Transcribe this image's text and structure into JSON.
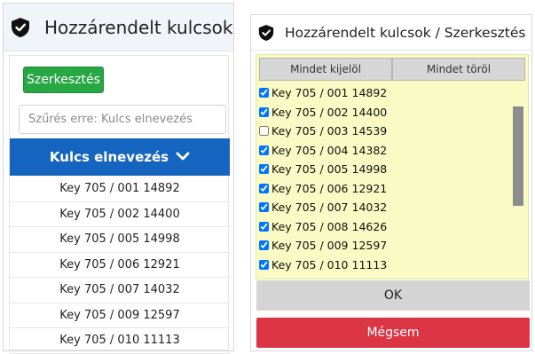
{
  "left_panel": {
    "title": "Hozzárendelt kulcsok",
    "edit_label": "Szerkesztés",
    "filter_placeholder": "Szűrés erre: Kulcs elnevezés",
    "column_header": "Kulcs elnevezés",
    "keys": [
      "Key 705 / 001 14892",
      "Key 705 / 002 14400",
      "Key 705 / 005 14998",
      "Key 705 / 006 12921",
      "Key 705 / 007 14032",
      "Key 705 / 009 12597",
      "Key 705 / 010 11113"
    ]
  },
  "dialog": {
    "title": "Hozzárendelt kulcsok / Szerkesztés",
    "select_all_label": "Mindet kijelöl",
    "clear_all_label": "Mindet töröl",
    "items": [
      {
        "label": "Key 705 / 001 14892",
        "checked": true
      },
      {
        "label": "Key 705 / 002 14400",
        "checked": true
      },
      {
        "label": "Key 705 / 003 14539",
        "checked": false
      },
      {
        "label": "Key 705 / 004 14382",
        "checked": true
      },
      {
        "label": "Key 705 / 005 14998",
        "checked": true
      },
      {
        "label": "Key 705 / 006 12921",
        "checked": true
      },
      {
        "label": "Key 705 / 007 14032",
        "checked": true
      },
      {
        "label": "Key 705 / 008 14626",
        "checked": true
      },
      {
        "label": "Key 705 / 009 12597",
        "checked": true
      },
      {
        "label": "Key 705 / 010 11113",
        "checked": true
      }
    ],
    "ok_label": "OK",
    "cancel_label": "Mégsem"
  },
  "icons": {
    "header": "shield-check-icon",
    "sort": "chevron-down-icon"
  },
  "colors": {
    "edit_button": "#28a745",
    "column_header": "#1565c0",
    "checklist_background": "#fafbc4",
    "cancel_button": "#dc3545"
  }
}
